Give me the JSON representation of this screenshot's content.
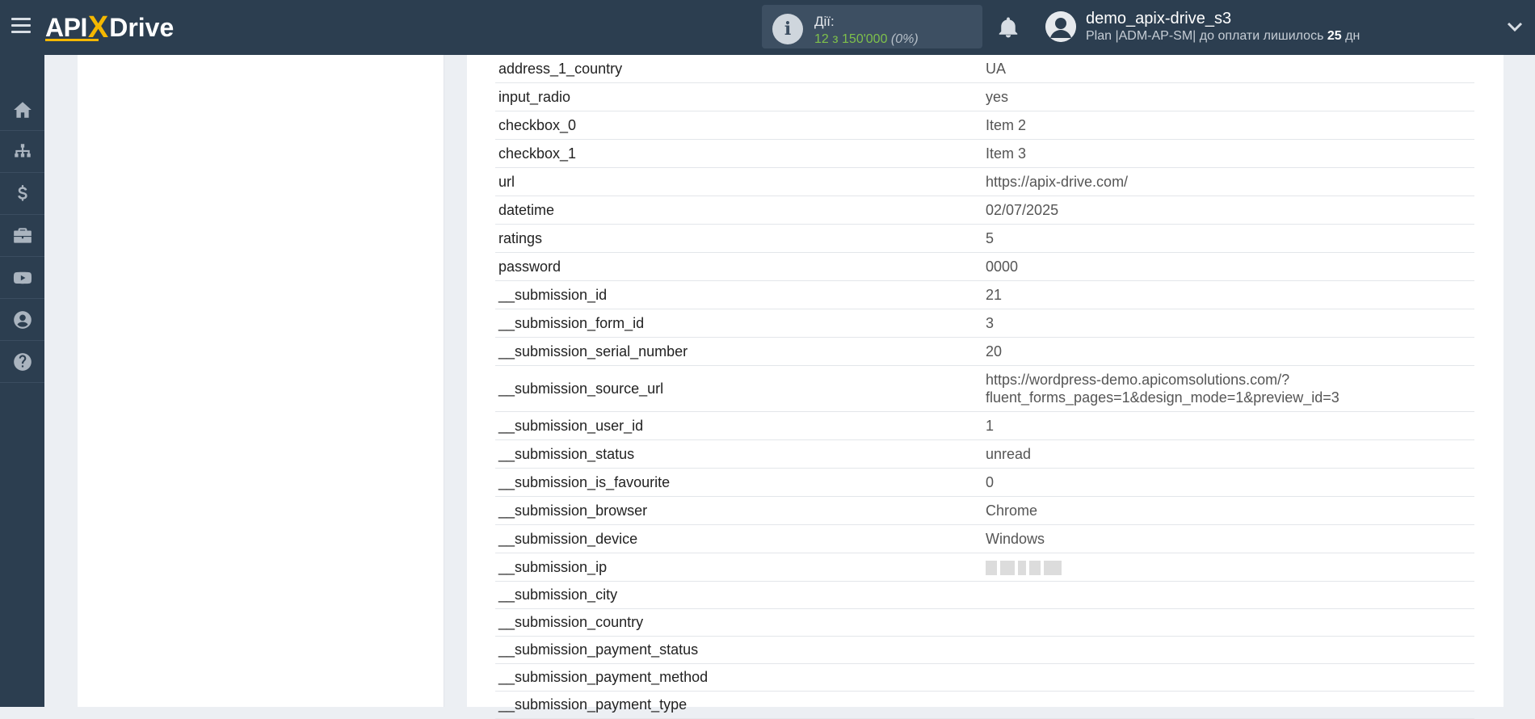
{
  "brand": {
    "apix": "API",
    "x": "X",
    "drive": "Drive"
  },
  "actions": {
    "label": "Дії:",
    "count": "12 з 150'000",
    "percent": "(0%)"
  },
  "user": {
    "name": "demo_apix-drive_s3",
    "plan_prefix": "Plan |ADM-AP-SM| до оплати лишилось",
    "days": "25",
    "days_suffix": "дн"
  },
  "sidebar": {
    "items": [
      "home-icon",
      "sitemap-icon",
      "dollar-icon",
      "briefcase-icon",
      "youtube-icon",
      "user-circle-icon",
      "question-icon"
    ]
  },
  "fields": [
    {
      "key": "address_1_country",
      "value": "UA"
    },
    {
      "key": "input_radio",
      "value": "yes"
    },
    {
      "key": "checkbox_0",
      "value": "Item 2"
    },
    {
      "key": "checkbox_1",
      "value": "Item 3"
    },
    {
      "key": "url",
      "value": "https://apix-drive.com/"
    },
    {
      "key": "datetime",
      "value": "02/07/2025"
    },
    {
      "key": "ratings",
      "value": "5"
    },
    {
      "key": "password",
      "value": "0000"
    },
    {
      "key": "__submission_id",
      "value": "21"
    },
    {
      "key": "__submission_form_id",
      "value": "3"
    },
    {
      "key": "__submission_serial_number",
      "value": "20"
    },
    {
      "key": "__submission_source_url",
      "value": "https://wordpress-demo.apicomsolutions.com/?",
      "value2": "fluent_forms_pages=1&design_mode=1&preview_id=3"
    },
    {
      "key": "__submission_user_id",
      "value": "1"
    },
    {
      "key": "__submission_status",
      "value": "unread"
    },
    {
      "key": "__submission_is_favourite",
      "value": "0"
    },
    {
      "key": "__submission_browser",
      "value": "Chrome"
    },
    {
      "key": "__submission_device",
      "value": "Windows"
    },
    {
      "key": "__submission_ip",
      "value": ""
    },
    {
      "key": "__submission_city",
      "value": ""
    },
    {
      "key": "__submission_country",
      "value": ""
    },
    {
      "key": "__submission_payment_status",
      "value": ""
    },
    {
      "key": "__submission_payment_method",
      "value": ""
    },
    {
      "key": "__submission_payment_type",
      "value": ""
    }
  ],
  "colors": {
    "topbar": "#2c3e50",
    "accent": "#f5b800",
    "count_green": "#7ec04b"
  }
}
